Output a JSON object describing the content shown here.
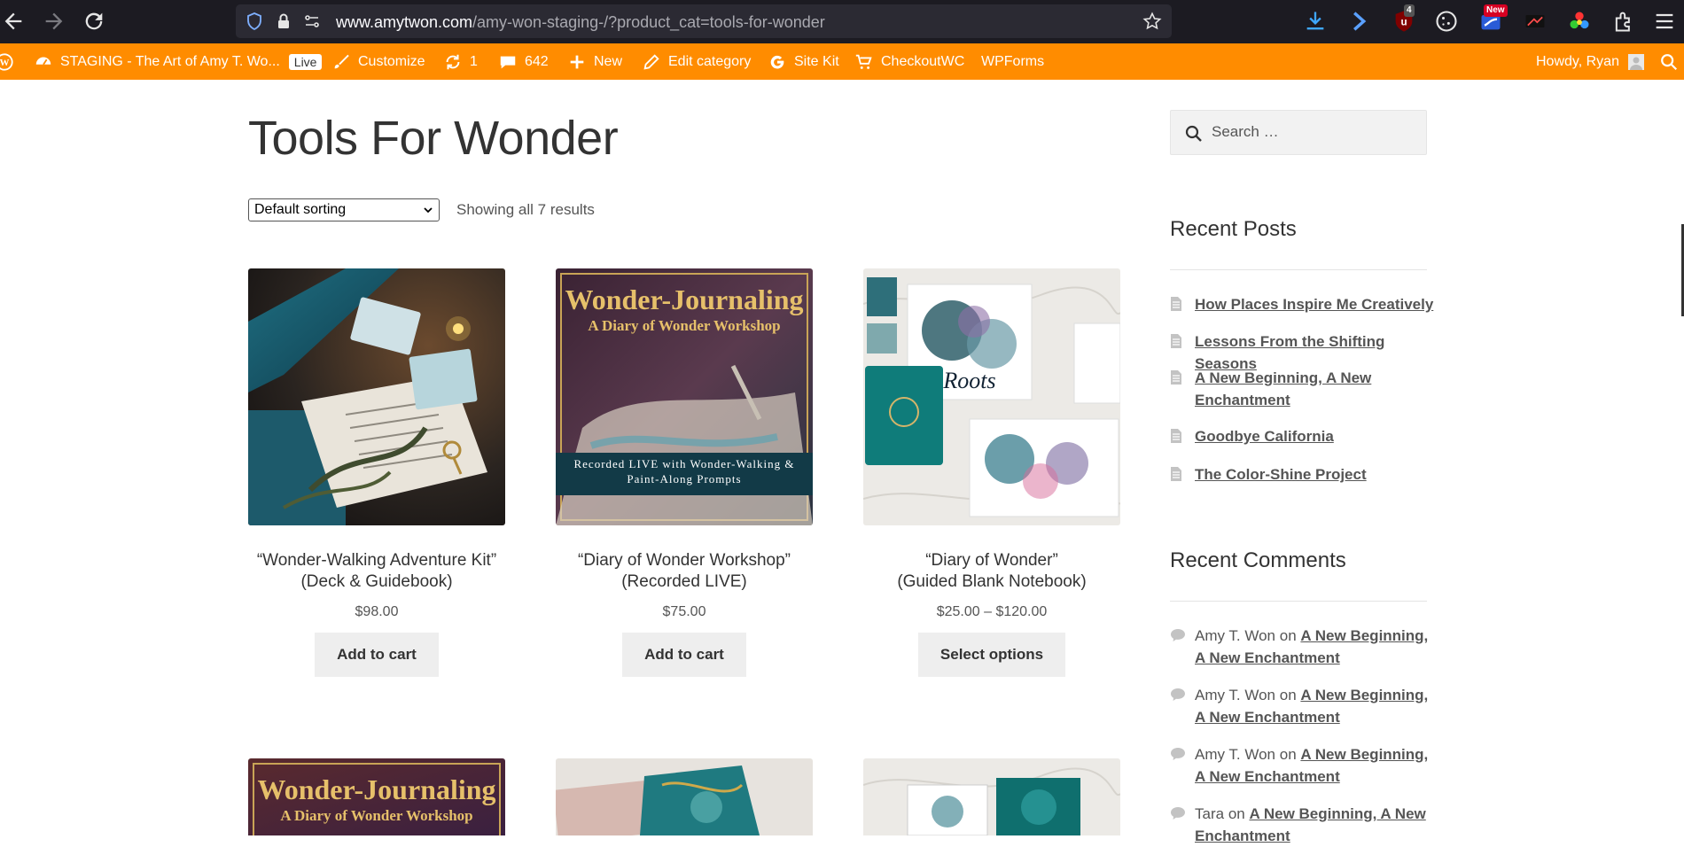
{
  "browser": {
    "url_domain": "www.amytwon.com",
    "url_path": "/amy-won-staging-/?product_cat=tools-for-wonder",
    "badge_ublock": "4",
    "badge_new": "New"
  },
  "adminbar": {
    "site_name": "STAGING - The Art of Amy T. Wo...",
    "live_label": "Live",
    "customize": "Customize",
    "updates_count": "1",
    "comments_count": "642",
    "new_label": "New",
    "edit_category": "Edit category",
    "site_kit": "Site Kit",
    "checkoutwc": "CheckoutWC",
    "wpforms": "WPForms",
    "howdy": "Howdy, Ryan"
  },
  "main": {
    "title": "Tools For Wonder",
    "sort_selected": "Default sorting",
    "result_count": "Showing all 7 results",
    "products": [
      {
        "title": "“Wonder-Walking Adventure Kit”\n(Deck & Guidebook)",
        "price": "$98.00",
        "button": "Add to cart"
      },
      {
        "title": "“Diary of Wonder Workshop”\n(Recorded LIVE)",
        "price": "$75.00",
        "button": "Add to cart",
        "img_title": "Wonder-Journaling",
        "img_sub": "A Diary of Wonder Workshop",
        "img_banner": "Recorded LIVE with Wonder-Walking & Paint-Along Prompts"
      },
      {
        "title": "“Diary of Wonder”\n(Guided Blank Notebook)",
        "price": "$25.00 – $120.00",
        "button": "Select options"
      }
    ],
    "row2_img_title": "Wonder-Journaling",
    "row2_img_sub": "A Diary of Wonder Workshop"
  },
  "sidebar": {
    "search_placeholder": "Search …",
    "recent_posts_title": "Recent Posts",
    "recent_posts": [
      "How Places Inspire Me Creatively",
      "Lessons From the Shifting Seasons",
      "A New Beginning, A New Enchantment",
      "Goodbye California",
      "The Color-Shine Project"
    ],
    "recent_comments_title": "Recent Comments",
    "comments": [
      {
        "author": "Amy T. Won",
        "on": "on",
        "post": "A New Beginning, A New Enchantment"
      },
      {
        "author": "Amy T. Won",
        "on": "on",
        "post": "A New Beginning, A New Enchantment"
      },
      {
        "author": "Amy T. Won",
        "on": "on",
        "post": "A New Beginning, A New Enchantment"
      },
      {
        "author": "Tara",
        "on": "on",
        "post": "A New Beginning, A New Enchantment"
      }
    ]
  },
  "colors": {
    "adminbar": "#ff8c00",
    "browser_bg": "#1c1b22",
    "button_bg": "#eeeeee",
    "link": "#555555"
  }
}
